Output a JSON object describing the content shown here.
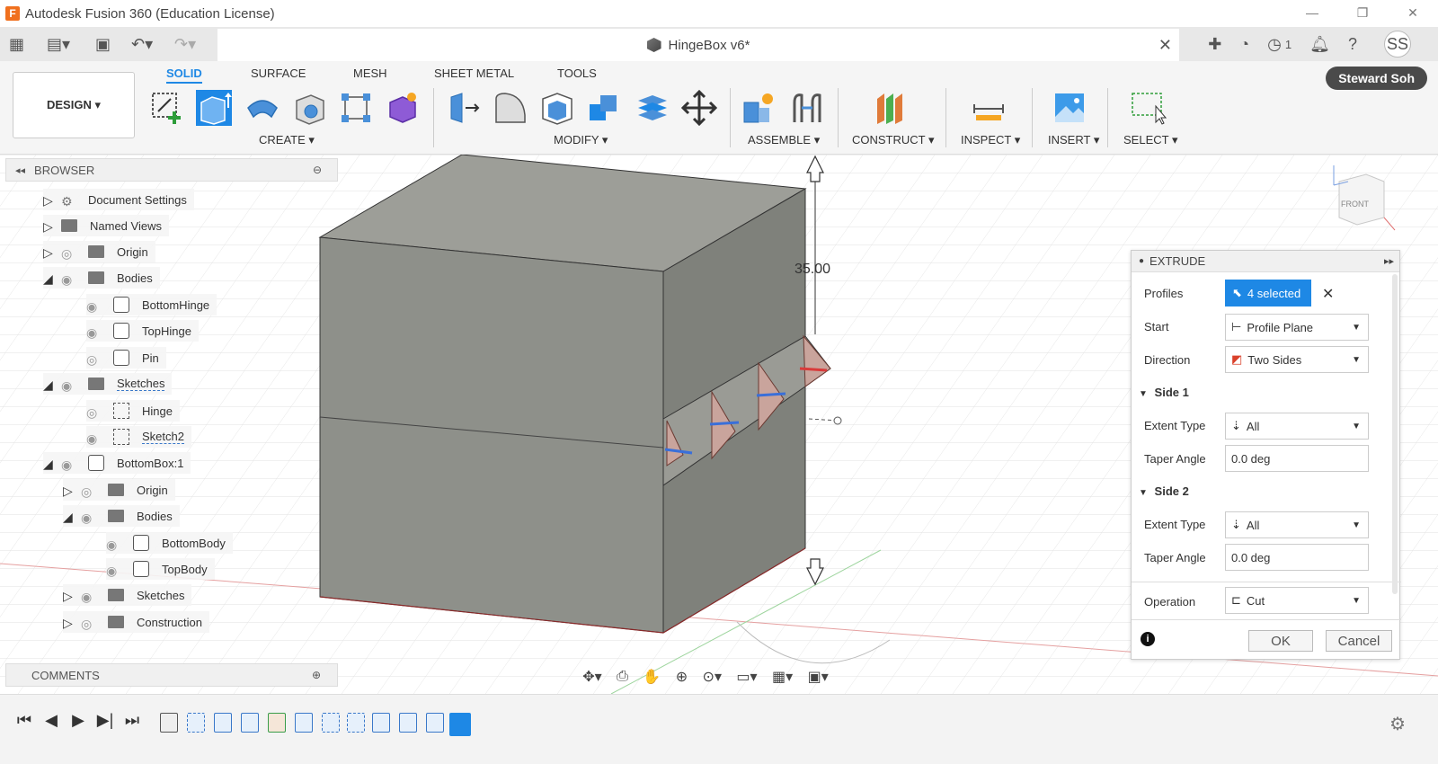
{
  "window": {
    "title": "Autodesk Fusion 360 (Education License)",
    "logo_letter": "F"
  },
  "tabbar": {
    "document_title": "HingeBox v6*",
    "job_count": "1",
    "user_initials": "SS"
  },
  "ribbon": {
    "workspace": "DESIGN ▾",
    "tabs": [
      "SOLID",
      "SURFACE",
      "MESH",
      "SHEET METAL",
      "TOOLS"
    ],
    "groups": [
      "CREATE ▾",
      "MODIFY ▾",
      "ASSEMBLE ▾",
      "CONSTRUCT ▾",
      "INSPECT ▾",
      "INSERT ▾",
      "SELECT ▾"
    ],
    "user_name": "Steward Soh"
  },
  "browser": {
    "title": "BROWSER",
    "items": [
      {
        "label": "Document Settings"
      },
      {
        "label": "Named Views"
      },
      {
        "label": "Origin"
      },
      {
        "label": "Bodies"
      },
      {
        "label": "BottomHinge"
      },
      {
        "label": "TopHinge"
      },
      {
        "label": "Pin"
      },
      {
        "label": "Sketches"
      },
      {
        "label": "Hinge"
      },
      {
        "label": "Sketch2"
      },
      {
        "label": "BottomBox:1"
      },
      {
        "label": "Origin"
      },
      {
        "label": "Bodies"
      },
      {
        "label": "BottomBody"
      },
      {
        "label": "TopBody"
      },
      {
        "label": "Sketches"
      },
      {
        "label": "Construction"
      }
    ]
  },
  "comments": {
    "title": "COMMENTS"
  },
  "canvas": {
    "dimension": "35.00",
    "viewcube_label": "FRONT"
  },
  "extrude": {
    "title": "EXTRUDE",
    "profiles_label": "Profiles",
    "profiles_value": "4 selected",
    "start_label": "Start",
    "start_value": "Profile Plane",
    "direction_label": "Direction",
    "direction_value": "Two Sides",
    "side1_label": "Side 1",
    "side1_extent_label": "Extent Type",
    "side1_extent_value": "All",
    "side1_taper_label": "Taper Angle",
    "side1_taper_value": "0.0 deg",
    "side2_label": "Side 2",
    "side2_extent_label": "Extent Type",
    "side2_extent_value": "All",
    "side2_taper_label": "Taper Angle",
    "side2_taper_value": "0.0 deg",
    "operation_label": "Operation",
    "operation_value": "Cut",
    "ok_label": "OK",
    "cancel_label": "Cancel"
  },
  "colors": {
    "accent": "#1e88e5",
    "box_top": "#9d9e98",
    "box_front": "#8e908a",
    "box_side": "#7d7f79",
    "profile": "#c9a49c"
  }
}
